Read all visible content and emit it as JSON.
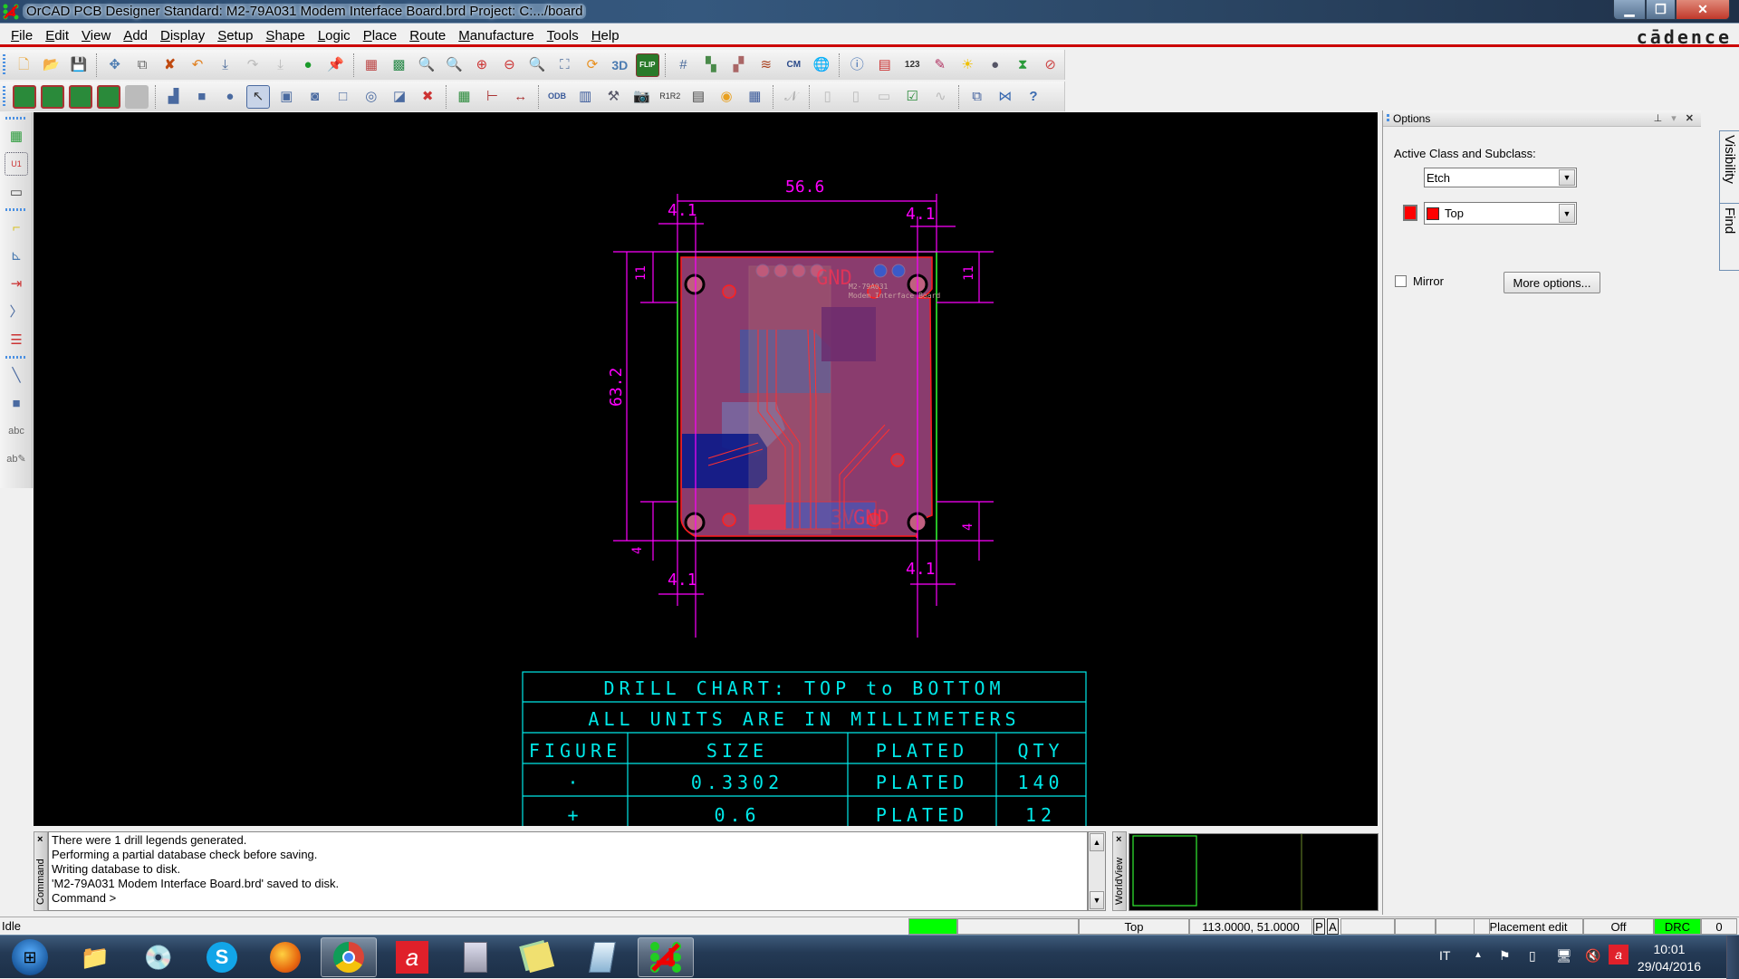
{
  "window": {
    "title": "OrCAD PCB Designer Standard: M2-79A031 Modem Interface Board.brd  Project: C:.../board",
    "brand": "cādence"
  },
  "menu": [
    {
      "label": "File",
      "accel": "F"
    },
    {
      "label": "Edit",
      "accel": "E"
    },
    {
      "label": "View",
      "accel": "V"
    },
    {
      "label": "Add",
      "accel": "A"
    },
    {
      "label": "Display",
      "accel": "D"
    },
    {
      "label": "Setup",
      "accel": "S"
    },
    {
      "label": "Shape",
      "accel": "S"
    },
    {
      "label": "Logic",
      "accel": "L"
    },
    {
      "label": "Place",
      "accel": "P"
    },
    {
      "label": "Route",
      "accel": "R"
    },
    {
      "label": "Manufacture",
      "accel": "M"
    },
    {
      "label": "Tools",
      "accel": "T"
    },
    {
      "label": "Help",
      "accel": "H"
    }
  ],
  "toolbar_row1": {
    "file": [
      "new-icon",
      "open-icon",
      "save-icon"
    ],
    "edit": [
      "move-icon",
      "copy-icon",
      "delete-icon",
      "undo-icon",
      "undo-list-icon",
      "redo-icon",
      "redo-list-icon",
      "done-icon",
      "pin-icon"
    ],
    "view": [
      "unrats-all-icon",
      "rats-all-icon",
      "zoom-fit-icon",
      "zoom-in-window-icon",
      "zoom-in-icon",
      "zoom-out-icon",
      "zoom-previous-icon",
      "zoom-world-icon",
      "redraw-icon",
      "3d-icon",
      "flip-icon"
    ],
    "setup": [
      "grid-icon",
      "color-icon",
      "shadow-icon",
      "layers-icon",
      "cm-icon",
      "web-icon"
    ],
    "display": [
      "info-icon",
      "show-element-icon",
      "measure-icon",
      "highlight-icon",
      "dehighlight-icon",
      "bomb-icon",
      "hourglass-icon",
      "unplace-icon"
    ]
  },
  "toolbar_row2": {
    "place": [
      "place-manual-icon",
      "place-quickplace-icon",
      "place-replace-icon",
      "place-swap-icon",
      "place-disabled-icon"
    ],
    "shape": [
      "shape-polygon-icon",
      "shape-rectangle-icon",
      "shape-circle-icon",
      "shape-select-icon",
      "shape-manual-void-icon",
      "shape-edit-boundary-icon",
      "shape-delete-islands-icon",
      "shape-change-type-icon",
      "shape-merge-icon",
      "shape-delete-icon"
    ],
    "manufacture": [
      "testprep-icon",
      "dimension-icon",
      "dimension-linear-icon"
    ],
    "export": [
      "odb-icon",
      "artwork-icon",
      "nc-drill-icon",
      "snapshot-icon",
      "renumber-icon",
      "report-icon",
      "testpoint-icon",
      "drill-legend-icon"
    ],
    "route": [
      "spread-icon",
      "glossary-icon",
      "glossary-doc-icon",
      "glossary-tray-icon",
      "check-icon",
      "wire-icon"
    ],
    "misc": [
      "multi-window-icon",
      "bowtie-icon",
      "help-icon"
    ]
  },
  "left_toolbar": [
    "place-component-icon",
    "place-u1-icon",
    "place-connector-icon",
    "add-connect-icon",
    "slide-icon",
    "delay-tune-icon",
    "custom-smooth-icon",
    "route-fanout-icon",
    "add-line-icon",
    "add-rect-icon",
    "add-text-icon",
    "edit-text-icon"
  ],
  "board": {
    "dim_width": "56.6",
    "dim_height": "63.2",
    "dim_offset": "4.1",
    "dim_hole_v": "11",
    "dim_edge": "4",
    "labels": [
      "GND",
      "3V",
      "GND",
      "M2-79A031",
      "Modem Interface Board"
    ]
  },
  "drill_chart": {
    "title": "DRILL CHART: TOP to BOTTOM",
    "subtitle": "ALL UNITS ARE IN MILLIMETERS",
    "headers": [
      "FIGURE",
      "SIZE",
      "PLATED",
      "QTY"
    ],
    "rows": [
      {
        "figure": "·",
        "size": "0.3302",
        "plated": "PLATED",
        "qty": "140"
      },
      {
        "figure": "+",
        "size": "0.6",
        "plated": "PLATED",
        "qty": "12"
      }
    ]
  },
  "options": {
    "header": "Options",
    "active_label": "Active Class and Subclass:",
    "class_value": "Etch",
    "subclass_value": "Top",
    "subclass_color": "#ff0000",
    "mirror_label": "Mirror",
    "mirror_checked": false,
    "more_options": "More options...",
    "tabs": [
      "Visibility",
      "Find"
    ]
  },
  "command": {
    "label": "Command",
    "lines": [
      "There were 1 drill legends generated.",
      "Performing a partial database check before saving.",
      "Writing database to disk.",
      "'M2-79A031 Modem Interface Board.brd' saved to disk.",
      "Command >"
    ]
  },
  "worldview": {
    "label": "WorldView"
  },
  "status": {
    "state": "Idle",
    "layer": "Top",
    "coords": "113.0000, 51.0000",
    "p": "P",
    "a": "A",
    "mode": "Placement edit",
    "off": "Off",
    "drc": "DRC",
    "drc_count": "0",
    "ready_color": "#00ff00"
  },
  "taskbar": {
    "apps": [
      "start-orb",
      "file-explorer",
      "media-center",
      "skype",
      "firefox",
      "chrome",
      "avira",
      "calculator",
      "sticky-notes",
      "notepad",
      "orcad-pcb"
    ],
    "language": "IT",
    "time": "10:01",
    "date": "29/04/2016"
  }
}
